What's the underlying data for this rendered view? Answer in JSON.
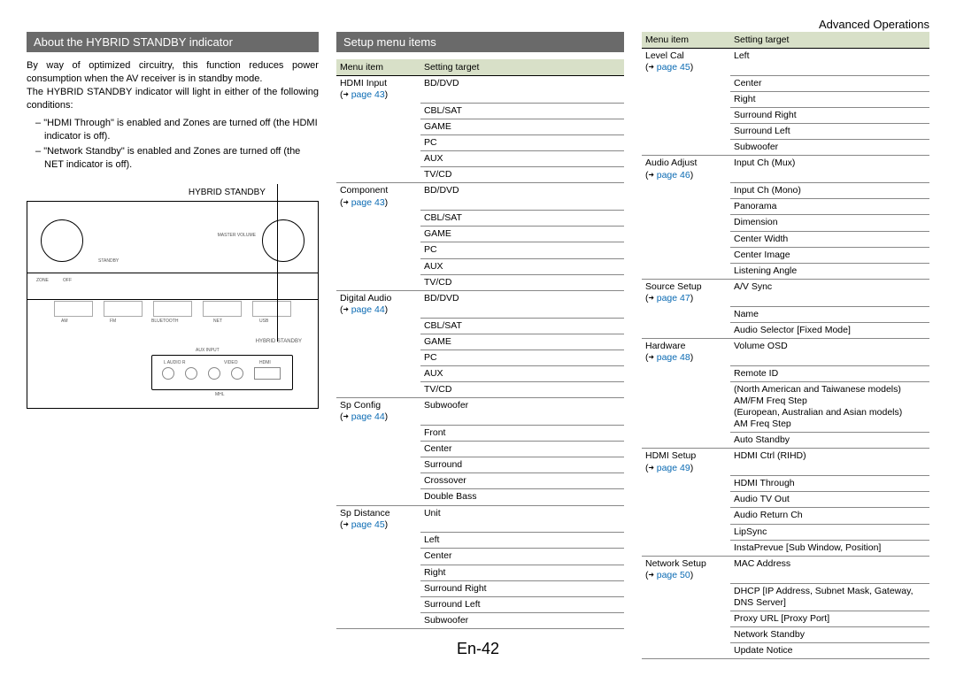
{
  "section_header": "Advanced Operations",
  "left": {
    "title": "About the HYBRID STANDBY indicator",
    "para1": "By way of optimized circuitry, this function reduces power consumption when the AV receiver is in standby mode.",
    "para2": "The HYBRID STANDBY indicator will light in either of the following conditions:",
    "bullet1": "\"HDMI Through\" is enabled and Zones are turned off (the HDMI indicator is off).",
    "bullet2": "\"Network Standby\" is enabled and Zones are turned off (the NET indicator is off).",
    "diagram_label": "HYBRID STANDBY"
  },
  "mid": {
    "title": "Setup menu items",
    "header_menu": "Menu item",
    "header_target": "Setting target",
    "groups": [
      {
        "menu": "HDMI Input",
        "page": "page 43",
        "rows": [
          "BD/DVD",
          "CBL/SAT",
          "GAME",
          "PC",
          "AUX",
          "TV/CD"
        ]
      },
      {
        "menu": "Component",
        "page": "page 43",
        "rows": [
          "BD/DVD",
          "CBL/SAT",
          "GAME",
          "PC",
          "AUX",
          "TV/CD"
        ]
      },
      {
        "menu": "Digital Audio",
        "page": "page 44",
        "rows": [
          "BD/DVD",
          "CBL/SAT",
          "GAME",
          "PC",
          "AUX",
          "TV/CD"
        ]
      },
      {
        "menu": "Sp Config",
        "page": "page 44",
        "rows": [
          "Subwoofer",
          "Front",
          "Center",
          "Surround",
          "Crossover",
          "Double Bass"
        ]
      },
      {
        "menu": "Sp Distance",
        "page": "page 45",
        "rows": [
          "Unit",
          "Left",
          "Center",
          "Right",
          "Surround Right",
          "Surround Left",
          "Subwoofer"
        ]
      }
    ]
  },
  "right": {
    "header_menu": "Menu item",
    "header_target": "Setting target",
    "groups": [
      {
        "menu": "Level Cal",
        "page": "page 45",
        "rows": [
          "Left",
          "Center",
          "Right",
          "Surround Right",
          "Surround Left",
          "Subwoofer"
        ]
      },
      {
        "menu": "Audio Adjust",
        "page": "page 46",
        "rows": [
          "Input Ch (Mux)",
          "Input Ch (Mono)",
          "Panorama",
          "Dimension",
          "Center Width",
          "Center Image",
          "Listening Angle"
        ]
      },
      {
        "menu": "Source Setup",
        "page": "page 47",
        "rows": [
          "A/V Sync",
          "Name",
          "Audio Selector [Fixed Mode]"
        ]
      },
      {
        "menu": "Hardware",
        "page": "page 48",
        "rows": [
          "Volume OSD",
          "Remote ID",
          "(North American and Taiwanese models)\nAM/FM Freq Step\n(European, Australian and Asian models)\nAM Freq Step",
          "Auto Standby"
        ]
      },
      {
        "menu": "HDMI Setup",
        "page": "page 49",
        "rows": [
          "HDMI Ctrl (RIHD)",
          "HDMI Through",
          "Audio TV Out",
          "Audio Return Ch",
          "LipSync",
          "InstaPrevue [Sub Window, Position]"
        ]
      },
      {
        "menu": "Network Setup",
        "page": "page 50",
        "rows": [
          "MAC Address",
          "DHCP [IP Address, Subnet Mask, Gateway, DNS Server]",
          "Proxy URL [Proxy Port]",
          "Network Standby",
          "Update Notice"
        ]
      }
    ]
  },
  "footer": "En-42",
  "arrow": "➜"
}
